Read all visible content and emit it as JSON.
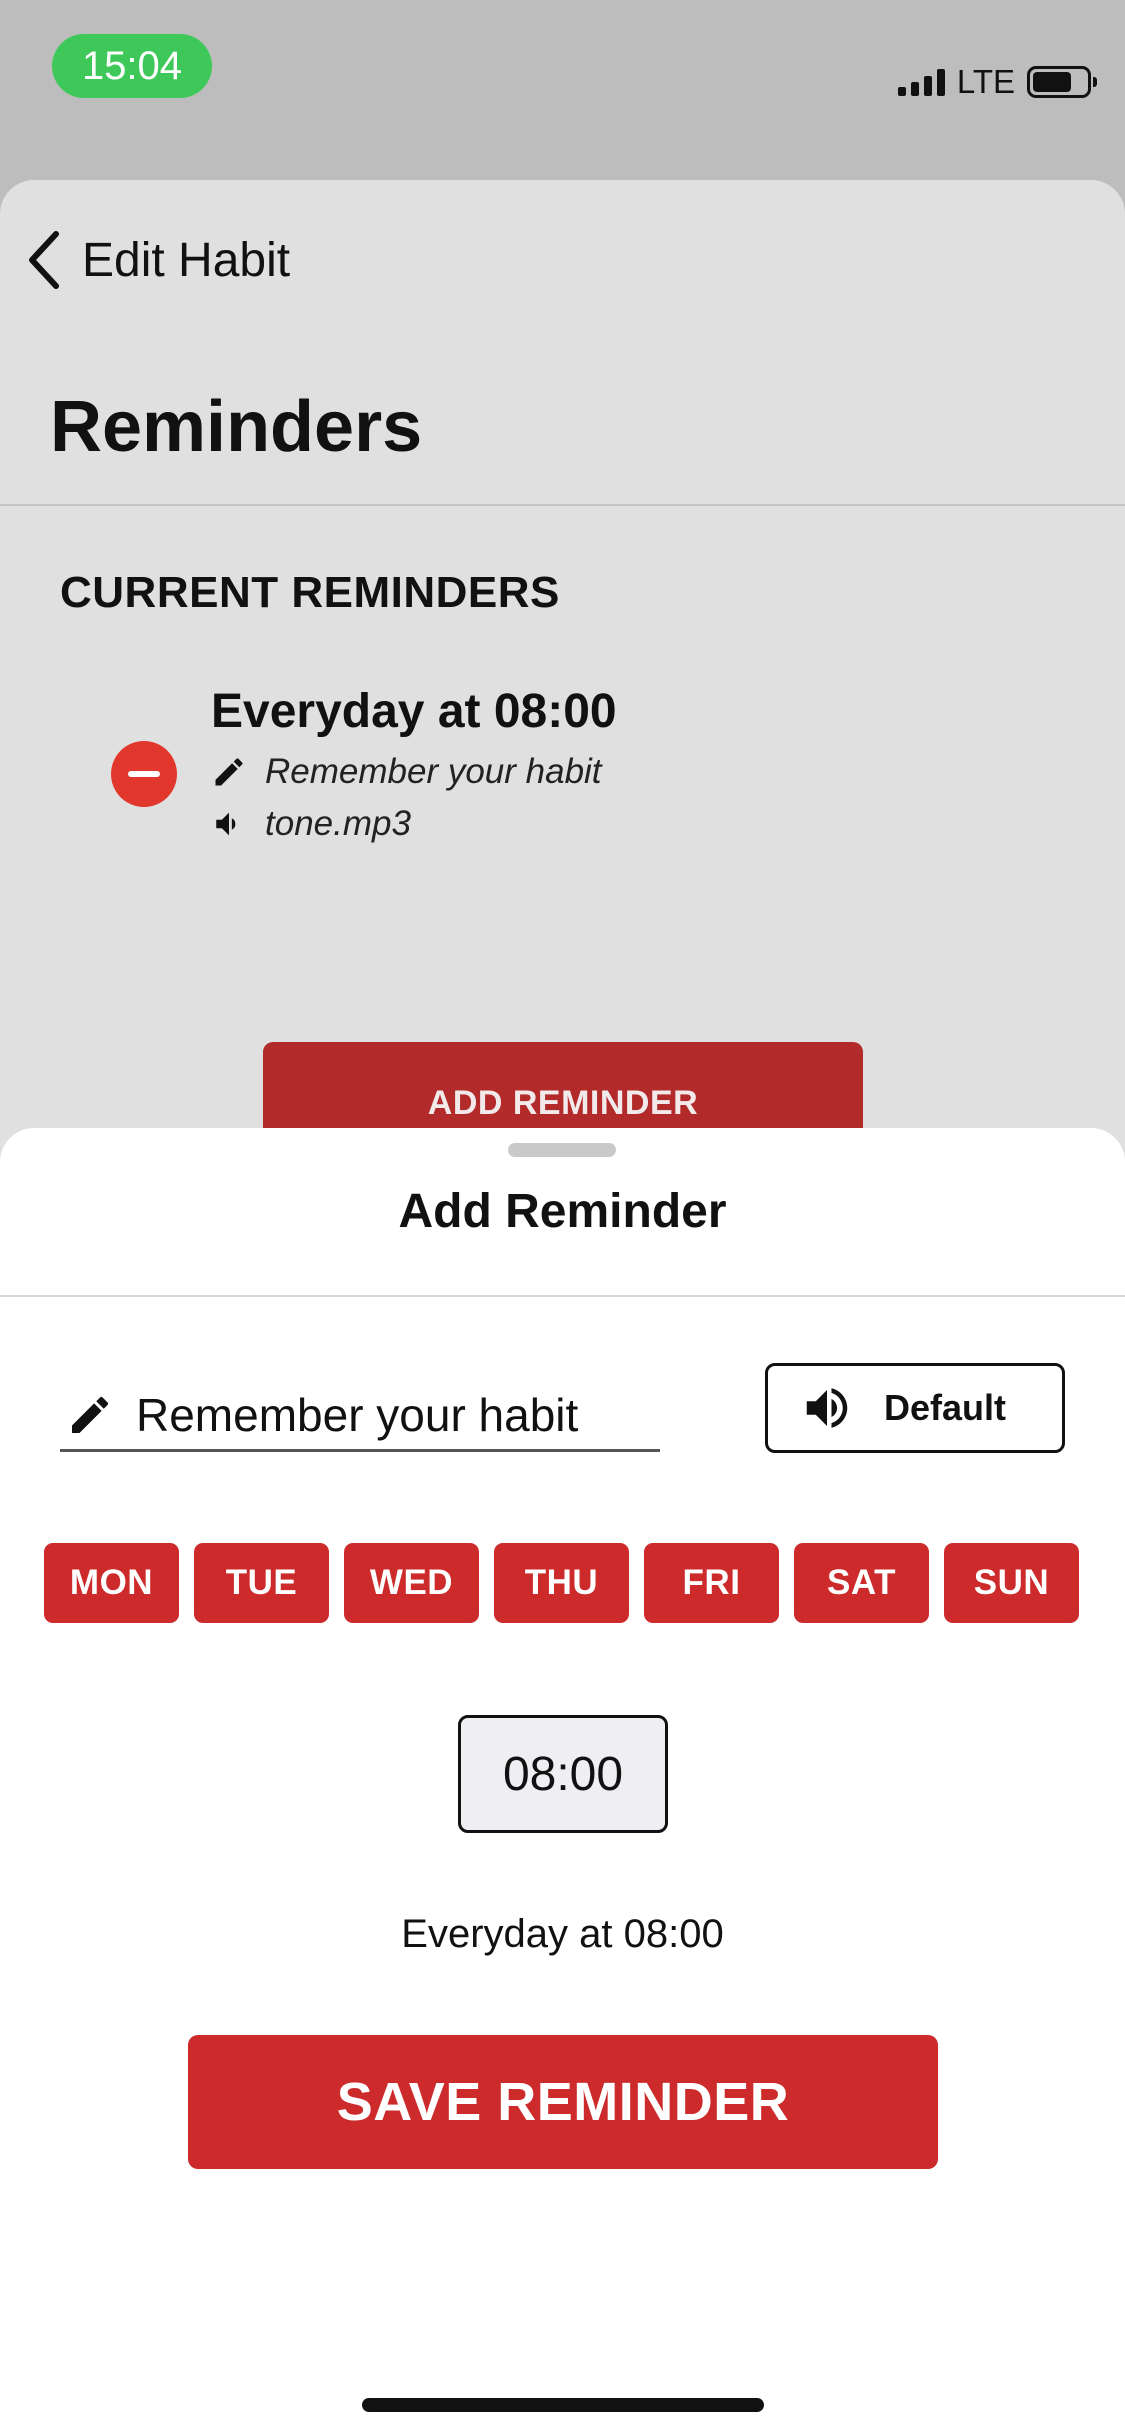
{
  "status_bar": {
    "time": "15:04",
    "network": "LTE",
    "battery_level": 0.74
  },
  "nav": {
    "back_label": "Edit Habit",
    "back_icon": "chevron-left-icon"
  },
  "page": {
    "title": "Reminders"
  },
  "current_reminders": {
    "heading": "CURRENT REMINDERS",
    "items": [
      {
        "title": "Everyday at 08:00",
        "message": "Remember your habit",
        "sound": "tone.mp3"
      }
    ]
  },
  "add_reminder_button": {
    "label": "ADD REMINDER"
  },
  "sheet": {
    "title": "Add Reminder",
    "message_value": "Remember your habit",
    "sound_label": "Default",
    "days": [
      "MON",
      "TUE",
      "WED",
      "THU",
      "FRI",
      "SAT",
      "SUN"
    ],
    "time": "08:00",
    "summary": "Everyday at 08:00",
    "save_label": "SAVE REMINDER"
  },
  "colors": {
    "accent_red": "#cd2b2b",
    "remove_red": "#e1372c",
    "status_green": "#3fc85a"
  }
}
